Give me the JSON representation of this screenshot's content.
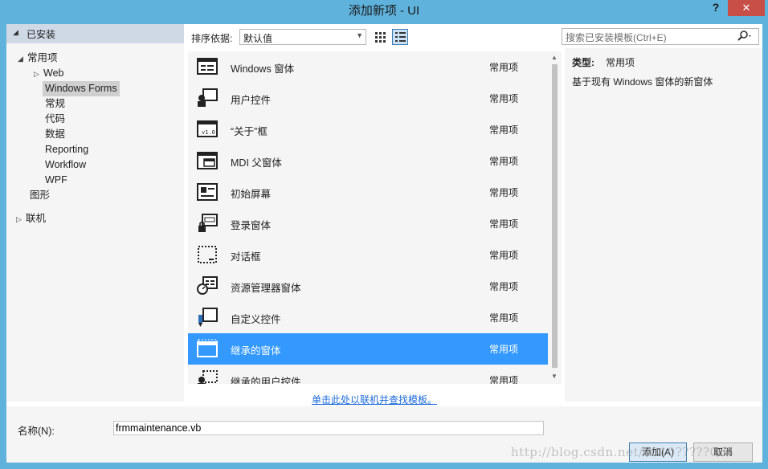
{
  "window": {
    "title": "添加新项 - UI",
    "help": "?",
    "close": "✕"
  },
  "tree": {
    "header": "已安装",
    "items": [
      {
        "label": "常用项",
        "arrow": "◢"
      },
      {
        "label": "Web",
        "arrow": "▷"
      },
      {
        "label": "Windows Forms",
        "arrow": ""
      },
      {
        "label": "常规",
        "arrow": ""
      },
      {
        "label": "代码",
        "arrow": ""
      },
      {
        "label": "数据",
        "arrow": ""
      },
      {
        "label": "Reporting",
        "arrow": ""
      },
      {
        "label": "Workflow",
        "arrow": ""
      },
      {
        "label": "WPF",
        "arrow": ""
      },
      {
        "label": "图形",
        "arrow": ""
      },
      {
        "label": "联机",
        "arrow": "▷"
      }
    ]
  },
  "toolbar": {
    "sort_label": "排序依据:",
    "sort_value": "默认值",
    "search_placeholder": "搜索已安装模板(Ctrl+E)"
  },
  "templates": [
    {
      "name": "Windows 窗体",
      "category": "常用项",
      "icon": "windows-form-icon"
    },
    {
      "name": "用户控件",
      "category": "常用项",
      "icon": "user-control-icon"
    },
    {
      "name": "“关于”框",
      "category": "常用项",
      "icon": "about-box-icon"
    },
    {
      "name": "MDI 父窗体",
      "category": "常用项",
      "icon": "mdi-parent-form-icon"
    },
    {
      "name": "初始屏幕",
      "category": "常用项",
      "icon": "splash-screen-icon"
    },
    {
      "name": "登录窗体",
      "category": "常用项",
      "icon": "login-form-icon"
    },
    {
      "name": "对话框",
      "category": "常用项",
      "icon": "dialog-icon"
    },
    {
      "name": "资源管理器窗体",
      "category": "常用项",
      "icon": "explorer-form-icon"
    },
    {
      "name": "自定义控件",
      "category": "常用项",
      "icon": "custom-control-icon"
    },
    {
      "name": "继承的窗体",
      "category": "常用项",
      "icon": "inherited-form-icon"
    },
    {
      "name": "继承的用户控件",
      "category": "常用项",
      "icon": "inherited-user-control-icon"
    }
  ],
  "details": {
    "type_key": "类型:",
    "type_value": "常用项",
    "description": "基于现有 Windows 窗体的新窗体"
  },
  "online_link": "单击此处以联机并查找模板。",
  "name_field": {
    "label": "名称(N):",
    "value": "frmmaintenance.vb"
  },
  "buttons": {
    "add": "添加(A)",
    "cancel": "取消"
  },
  "watermark": "http://blog.csdn.net/u010?????064",
  "colors": {
    "selection": "#3399ff",
    "title_bar": "#5fb2dc",
    "close_button": "#c74f48"
  }
}
